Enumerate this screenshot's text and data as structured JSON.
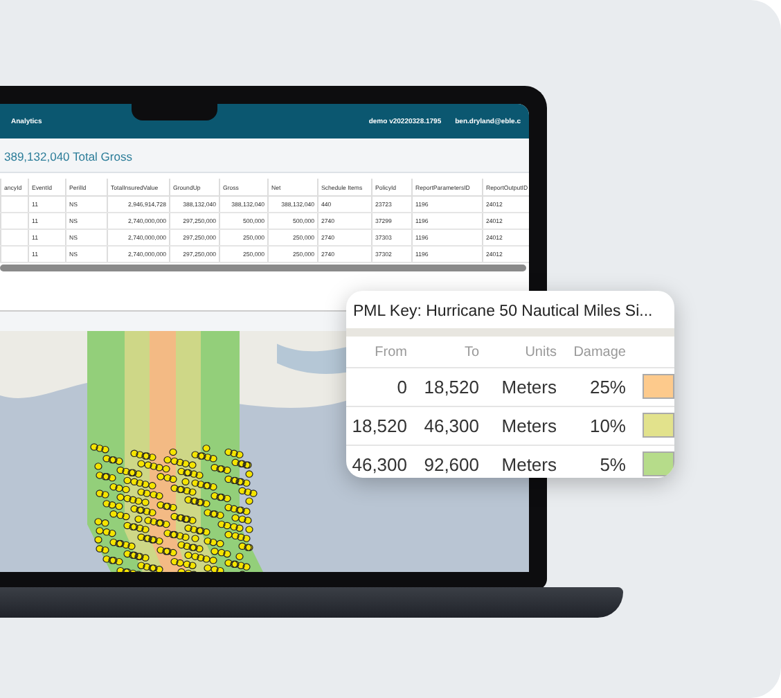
{
  "app_bar": {
    "title": "Analytics",
    "version": "demo v20220328.1795",
    "user": "ben.dryland@eble.c"
  },
  "summary": {
    "heading": "389,132,040 Total Gross"
  },
  "table": {
    "columns": [
      "ancyId",
      "EventId",
      "PerilId",
      "TotalInsuredValue",
      "GroundUp",
      "Gross",
      "Net",
      "Schedule Items",
      "PolicyId",
      "ReportParametersID",
      "ReportOutputID"
    ],
    "rows": [
      [
        "",
        "11",
        "NS",
        "2,946,914,728",
        "388,132,040",
        "388,132,040",
        "388,132,040",
        "440",
        "23723",
        "1196",
        "24012"
      ],
      [
        "",
        "11",
        "NS",
        "2,740,000,000",
        "297,250,000",
        "500,000",
        "500,000",
        "2740",
        "37299",
        "1196",
        "24012"
      ],
      [
        "",
        "11",
        "NS",
        "2,740,000,000",
        "297,250,000",
        "250,000",
        "250,000",
        "2740",
        "37303",
        "1196",
        "24012"
      ],
      [
        "",
        "11",
        "NS",
        "2,740,000,000",
        "297,250,000",
        "250,000",
        "250,000",
        "2740",
        "37302",
        "1196",
        "24012"
      ]
    ]
  },
  "pml_key": {
    "title": "PML Key: Hurricane 50 Nautical Miles Si...",
    "columns": [
      "From",
      "To",
      "Units",
      "Damage"
    ],
    "rows": [
      {
        "from": "0",
        "to": "18,520",
        "units": "Meters",
        "damage": "25%",
        "color": "#fdca8c"
      },
      {
        "from": "18,520",
        "to": "46,300",
        "units": "Meters",
        "damage": "10%",
        "color": "#e2e28c"
      },
      {
        "from": "46,300",
        "to": "92,600",
        "units": "Meters",
        "damage": "5%",
        "color": "#b6dc8a"
      }
    ]
  }
}
